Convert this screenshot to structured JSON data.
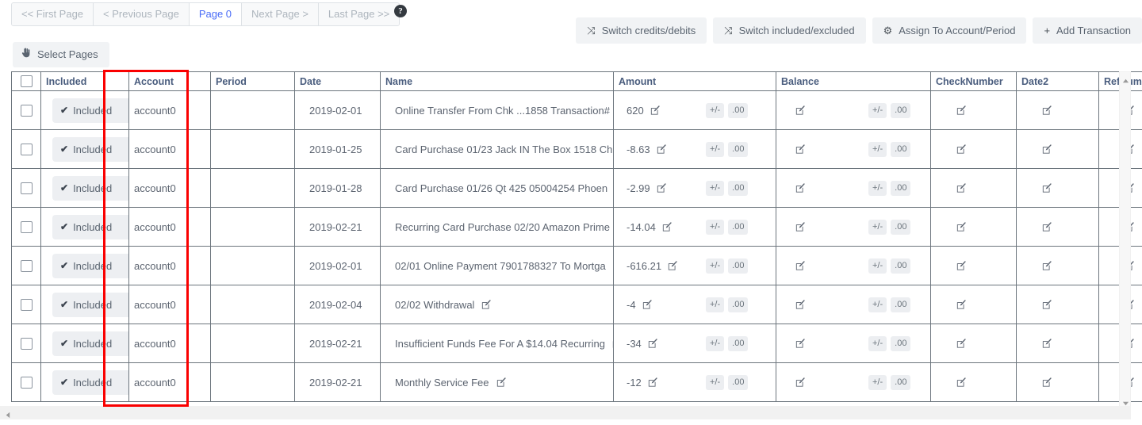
{
  "pager": {
    "items": [
      {
        "label": "<< First Page",
        "active": false
      },
      {
        "label": "< Previous Page",
        "active": false
      },
      {
        "label": "Page 0",
        "active": true
      },
      {
        "label": "Next Page >",
        "active": false
      },
      {
        "label": "Last Page >>",
        "active": false
      }
    ],
    "help_icon": "?"
  },
  "select_pages": {
    "label": "Select Pages",
    "icon": "👆"
  },
  "actions": [
    {
      "label": "Switch credits/debits",
      "icon": "⤨"
    },
    {
      "label": "Switch included/excluded",
      "icon": "⤨"
    },
    {
      "label": "Assign To Account/Period",
      "icon": "⚙"
    },
    {
      "label": "Add Transaction",
      "icon": "+"
    }
  ],
  "table": {
    "columns": [
      "",
      "Included",
      "Account",
      "Period",
      "Date",
      "Name",
      "Amount",
      "Balance",
      "CheckNumber",
      "Date2",
      "RefNumber"
    ],
    "included_label": "Included",
    "plus_minus_label": "+/-",
    "decimal_label": ".00",
    "rows": [
      {
        "included": "Included",
        "account": "account0",
        "period": "",
        "date": "2019-02-01",
        "name": "Online Transfer From Chk ...1858 Transaction#",
        "amount": "620",
        "balance": "",
        "checknumber": "",
        "date2": "",
        "refnumber": ""
      },
      {
        "included": "Included",
        "account": "account0",
        "period": "",
        "date": "2019-01-25",
        "name": "Card Purchase 01/23 Jack IN The Box 1518 Ch",
        "amount": "-8.63",
        "balance": "",
        "checknumber": "",
        "date2": "",
        "refnumber": ""
      },
      {
        "included": "Included",
        "account": "account0",
        "period": "",
        "date": "2019-01-28",
        "name": "Card Purchase 01/26 Qt 425 05004254 Phoen",
        "amount": "-2.99",
        "balance": "",
        "checknumber": "",
        "date2": "",
        "refnumber": ""
      },
      {
        "included": "Included",
        "account": "account0",
        "period": "",
        "date": "2019-02-21",
        "name": "Recurring Card Purchase 02/20 Amazon Prime",
        "amount": "-14.04",
        "balance": "",
        "checknumber": "",
        "date2": "",
        "refnumber": ""
      },
      {
        "included": "Included",
        "account": "account0",
        "period": "",
        "date": "2019-02-01",
        "name": "02/01 Online Payment 7901788327 To Mortga",
        "amount": "-616.21",
        "balance": "",
        "checknumber": "",
        "date2": "",
        "refnumber": ""
      },
      {
        "included": "Included",
        "account": "account0",
        "period": "",
        "date": "2019-02-04",
        "name": "02/02 Withdrawal",
        "amount": "-4",
        "balance": "",
        "checknumber": "",
        "date2": "",
        "refnumber": ""
      },
      {
        "included": "Included",
        "account": "account0",
        "period": "",
        "date": "2019-02-21",
        "name": "Insufficient Funds Fee For A $14.04 Recurring",
        "amount": "-34",
        "balance": "",
        "checknumber": "",
        "date2": "",
        "refnumber": ""
      },
      {
        "included": "Included",
        "account": "account0",
        "period": "",
        "date": "2019-02-21",
        "name": "Monthly Service Fee",
        "amount": "-12",
        "balance": "",
        "checknumber": "",
        "date2": "",
        "refnumber": ""
      }
    ]
  },
  "annotation": {
    "color": "#fa0000",
    "target_column": "Account"
  }
}
